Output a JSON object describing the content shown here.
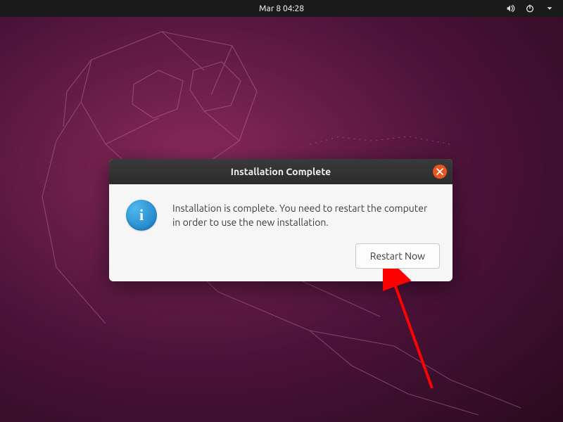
{
  "topbar": {
    "datetime": "Mar 8  04:28"
  },
  "dialog": {
    "title": "Installation Complete",
    "message": "Installation is complete. You need to restart the computer in order to use the new installation.",
    "restart_button": "Restart Now"
  }
}
